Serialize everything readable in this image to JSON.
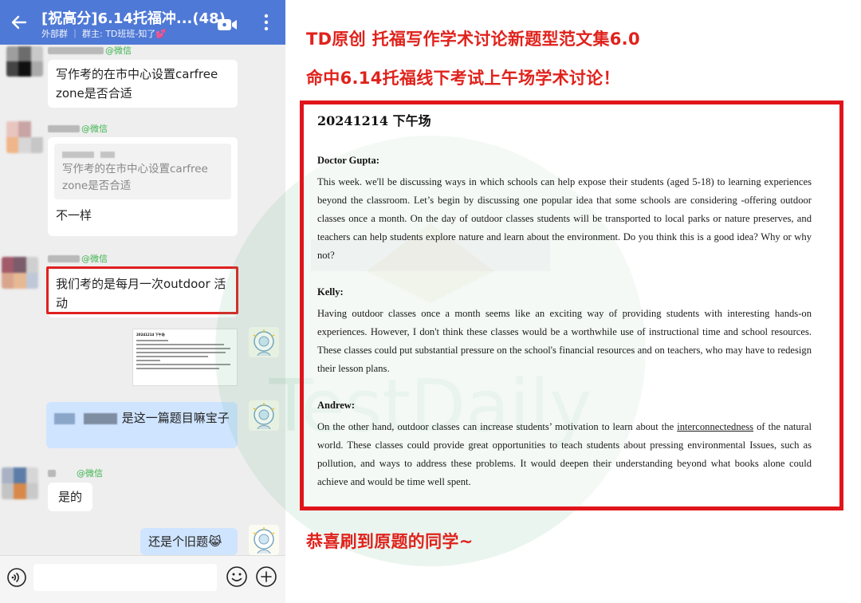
{
  "chat": {
    "back_icon": "arrow-left-icon",
    "title": "[祝高分]6.14托福冲...(48)",
    "subtitle": "外部群 ｜ 群主: TD班班-知了💕",
    "header_color": "#4f79d6",
    "messages": [
      {
        "sender": "@微信",
        "text": "写作考的在市中心设置carfree zone是否合适"
      },
      {
        "sender": "@微信",
        "quote": "写作考的在市中心设置carfree zone是否合适",
        "text": "不一样"
      },
      {
        "sender": "@微信",
        "text": "我们考的是每月一次outdoor 活动"
      },
      {
        "mine": true,
        "type": "image",
        "thumb_title": "20241214 下午场"
      },
      {
        "mine": true,
        "text": "是这一篇题目嘛宝子"
      },
      {
        "sender": "@微信",
        "text": "是的"
      },
      {
        "mine": true,
        "text": "还是个旧题😹"
      }
    ],
    "input_placeholder": ""
  },
  "promo": {
    "headline_1": "TD原创 托福写作学术讨论新题型范文集6.0",
    "headline_2": "命中6.14托福线下考试上午场学术讨论！",
    "footer": "恭喜刷到原题的同学~",
    "accent_color": "#e0221c",
    "watermark": "TestDaily",
    "document": {
      "heading": "20241214 下午场",
      "speaker_1": "Doctor Gupta:",
      "para_1": "This week. we'll be discussing ways in which schools can help expose their students (aged 5-18) to learning experiences beyond the classroom. Let’s begin by discussing one popular idea that some schools are considering -offering outdoor classes once a month. On the day of outdoor classes students will be transported to local parks or nature preserves, and teachers can help students explore nature and learn about the environment. Do you think this is a good idea? Why or why not?",
      "speaker_2": "Kelly:",
      "para_2": "Having outdoor classes once a month seems like an exciting way of providing students with interesting hands-on experiences. However, I don't think these classes would be a worthwhile use of instructional time and school resources. These classes could put substantial pressure on the school's financial resources and on teachers, who may have to redesign their lesson plans.",
      "speaker_3": "Andrew:",
      "para_3_before": "On the other hand, outdoor classes can increase students’ motivation to learn about the ",
      "para_3_underlined": "interconnectedness",
      "para_3_after": " of the natural world. These classes could provide great opportunities to teach students about pressing environmental Issues, such as pollution, and ways to address these problems. It would deepen their understanding beyond what books alone could achieve and would be time well spent."
    }
  }
}
